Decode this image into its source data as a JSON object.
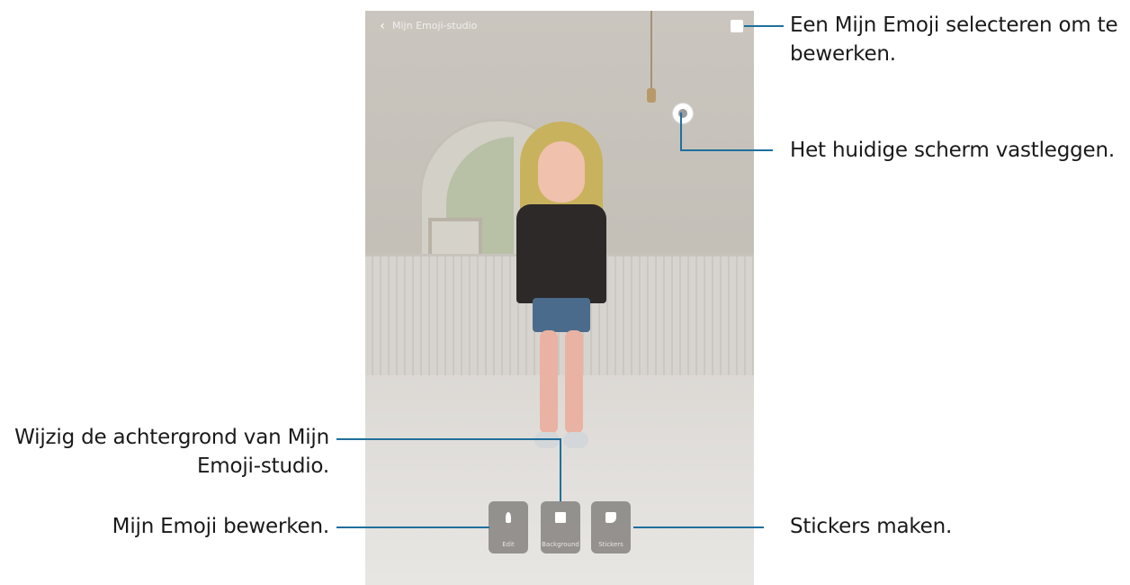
{
  "app": {
    "title": "Mijn Emoji-studio",
    "back_icon": "back-arrow-icon"
  },
  "bottom_bar": {
    "edit_label": "Edit",
    "background_label": "Background",
    "stickers_label": "Stickers"
  },
  "callouts": {
    "select_emoji": "Een Mijn Emoji selecteren om te bewerken.",
    "capture": "Het huidige scherm vastleggen.",
    "background": "Wijzig de achtergrond van Mijn Emoji-studio.",
    "edit": "Mijn Emoji bewerken.",
    "stickers": "Stickers maken."
  },
  "colors": {
    "callout_line": "#1f6f9c",
    "text": "#1a1a1a"
  }
}
